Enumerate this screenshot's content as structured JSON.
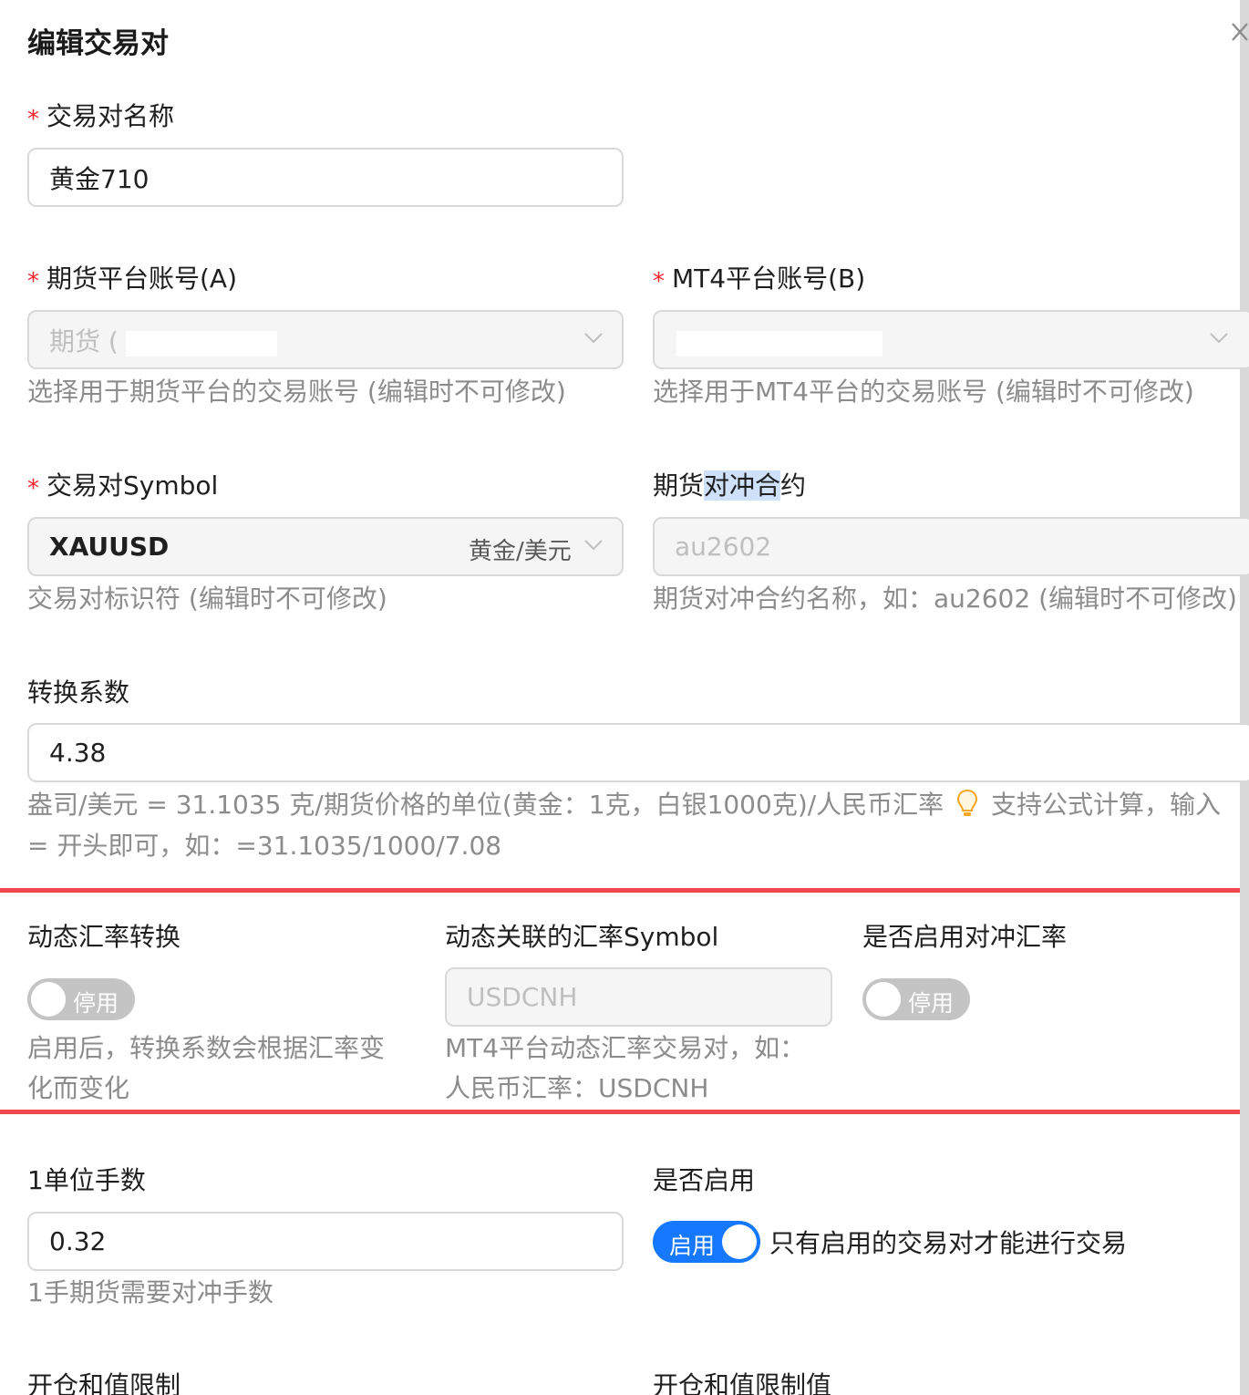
{
  "dialog": {
    "title": "编辑交易对"
  },
  "pair_name": {
    "label": "交易对名称",
    "value": "黄金710"
  },
  "futures_account": {
    "label": "期货平台账号(A)",
    "value": "期货 (",
    "help": "选择用于期货平台的交易账号 (编辑时不可修改)"
  },
  "mt4_account": {
    "label": "MT4平台账号(B)",
    "help": "选择用于MT4平台的交易账号 (编辑时不可修改)"
  },
  "symbol": {
    "label": "交易对Symbol",
    "value": "XAUUSD",
    "subtext": "黄金/美元",
    "help": "交易对标识符 (编辑时不可修改)"
  },
  "hedge_contract": {
    "label_a": "期货",
    "label_b": "对冲合",
    "label_c": "约",
    "value": "au2602",
    "help": "期货对冲合约名称，如：au2602 (编辑时不可修改)"
  },
  "conversion": {
    "label": "转换系数",
    "value": "4.38",
    "help_line1_a": "盎司/美元 = 31.1035 克/期货价格的单位(黄金：1克，白银1000克)/人民币汇率",
    "help_line1_b": "支持公式计算，输入",
    "help_line2": "= 开头即可，如：=31.1035/1000/7.08"
  },
  "dynamic_rate": {
    "label": "动态汇率转换",
    "switch_text": "停用",
    "help_line1": "启用后，转换系数会根据汇率变",
    "help_line2": "化而变化"
  },
  "rate_symbol": {
    "label": "动态关联的汇率Symbol",
    "value": "USDCNH",
    "help_line1": "MT4平台动态汇率交易对，如：",
    "help_line2": "人民币汇率：USDCNH"
  },
  "hedge_rate": {
    "label": "是否启用对冲汇率",
    "switch_text": "停用"
  },
  "lot": {
    "label": "1单位手数",
    "value": "0.32",
    "help": "1手期货需要对冲手数"
  },
  "enabled": {
    "label": "是否启用",
    "switch_text": "启用",
    "note": "只有启用的交易对才能进行交易"
  },
  "limit": {
    "label": "开仓和值限制"
  },
  "limit_value": {
    "label": "开仓和值限制值"
  },
  "colors": {
    "required": "#f5222d",
    "switch_on": "#1677ff",
    "switch_off": "#c4c4c4",
    "red_divider": "#f0474f",
    "selection_highlight": "#cfe0fb"
  },
  "icons": [
    "close-icon",
    "chevron-down-icon",
    "lightbulb-icon"
  ]
}
